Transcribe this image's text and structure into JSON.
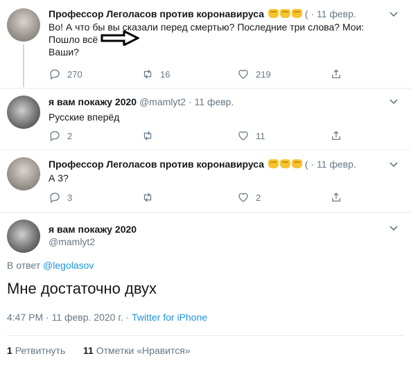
{
  "tweets": [
    {
      "name": "Профессор Леголасов против коронавируса",
      "truncated": "(",
      "sep": "·",
      "date": "11 февр.",
      "lines": [
        "Во! А что бы вы сказали перед смертью? Последние три слова? Мои:",
        "Пошло всё",
        "Ваши?"
      ],
      "replies": "270",
      "retweets": "16",
      "likes": "219"
    },
    {
      "name": "я вам покажу 2020",
      "handle": "@mamlyt2",
      "sep": "·",
      "date": "11 февр.",
      "lines": [
        "Русские вперёд"
      ],
      "replies": "2",
      "retweets": "",
      "likes": "11"
    },
    {
      "name": "Профессор Леголасов против коронавируса",
      "truncated": "(",
      "sep": "·",
      "date": "11 февр.",
      "lines": [
        "А 3?"
      ],
      "replies": "3",
      "retweets": "",
      "likes": "2"
    }
  ],
  "main": {
    "name": "я вам покажу 2020",
    "handle": "@mamlyt2",
    "replying_prefix": "В ответ",
    "replying_to": "@legolasov",
    "text": "Мне достаточно двух",
    "time": "4:47 PM · 11 февр. 2020 г.",
    "sep": "·",
    "source": "Twitter for iPhone",
    "retweets_count": "1",
    "retweets_label": "Ретвитнуть",
    "likes_count": "11",
    "likes_label": "Отметки «Нравится»"
  },
  "colors": {
    "link": "#1b95e0",
    "muted": "#657786",
    "text": "#14171a"
  }
}
